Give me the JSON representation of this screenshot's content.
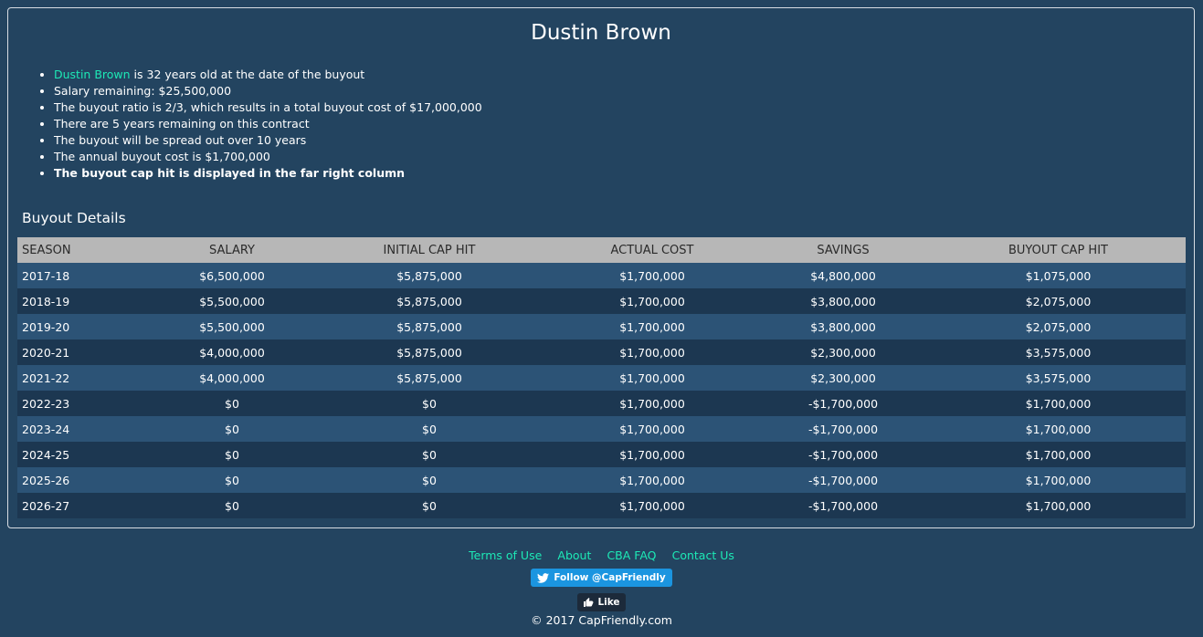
{
  "player": {
    "name": "Dustin Brown"
  },
  "facts": {
    "item1_link": "Dustin Brown",
    "item1_rest": " is 32 years old at the date of the buyout",
    "item2": "Salary remaining: $25,500,000",
    "item3": "The buyout ratio is 2/3, which results in a total buyout cost of $17,000,000",
    "item4": "There are 5 years remaining on this contract",
    "item5": "The buyout will be spread out over 10 years",
    "item6": "The annual buyout cost is $1,700,000",
    "item7": "The buyout cap hit is displayed in the far right column"
  },
  "section_title": "Buyout Details",
  "table": {
    "headers": [
      "SEASON",
      "SALARY",
      "INITIAL CAP HIT",
      "ACTUAL COST",
      "SAVINGS",
      "BUYOUT CAP HIT"
    ],
    "rows": [
      [
        "2017-18",
        "$6,500,000",
        "$5,875,000",
        "$1,700,000",
        "$4,800,000",
        "$1,075,000"
      ],
      [
        "2018-19",
        "$5,500,000",
        "$5,875,000",
        "$1,700,000",
        "$3,800,000",
        "$2,075,000"
      ],
      [
        "2019-20",
        "$5,500,000",
        "$5,875,000",
        "$1,700,000",
        "$3,800,000",
        "$2,075,000"
      ],
      [
        "2020-21",
        "$4,000,000",
        "$5,875,000",
        "$1,700,000",
        "$2,300,000",
        "$3,575,000"
      ],
      [
        "2021-22",
        "$4,000,000",
        "$5,875,000",
        "$1,700,000",
        "$2,300,000",
        "$3,575,000"
      ],
      [
        "2022-23",
        "$0",
        "$0",
        "$1,700,000",
        "-$1,700,000",
        "$1,700,000"
      ],
      [
        "2023-24",
        "$0",
        "$0",
        "$1,700,000",
        "-$1,700,000",
        "$1,700,000"
      ],
      [
        "2024-25",
        "$0",
        "$0",
        "$1,700,000",
        "-$1,700,000",
        "$1,700,000"
      ],
      [
        "2025-26",
        "$0",
        "$0",
        "$1,700,000",
        "-$1,700,000",
        "$1,700,000"
      ],
      [
        "2026-27",
        "$0",
        "$0",
        "$1,700,000",
        "-$1,700,000",
        "$1,700,000"
      ]
    ]
  },
  "footer": {
    "links": [
      "Terms of Use",
      "About",
      "CBA FAQ",
      "Contact Us"
    ],
    "twitter_label": "Follow @CapFriendly",
    "twitter_icon": "twitter-bird-icon",
    "facebook_label": "Like",
    "facebook_icon": "thumbs-up-icon",
    "copyright": "© 2017 CapFriendly.com"
  },
  "colors": {
    "background": "#234460",
    "link": "#1de9b6",
    "header_row": "#b7b7b7",
    "row_odd": "#2c5376",
    "row_even": "#1c3751",
    "twitter": "#1b95e0"
  }
}
